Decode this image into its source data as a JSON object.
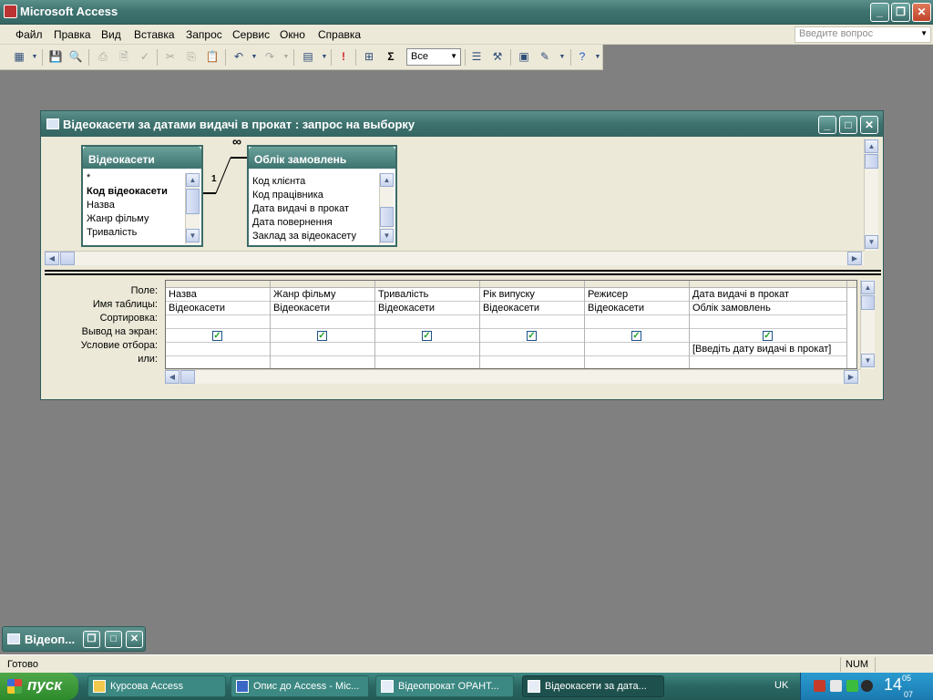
{
  "app": {
    "title": "Microsoft Access"
  },
  "menubar": {
    "items": [
      "Файл",
      "Правка",
      "Вид",
      "Вставка",
      "Запрос",
      "Сервис",
      "Окно",
      "Справка"
    ],
    "ask_placeholder": "Введите вопрос"
  },
  "toolbar": {
    "top_values": "Все"
  },
  "query_window": {
    "title": "Відеокасети за датами видачі в прокат : запрос на выборку",
    "tables": [
      {
        "name": "Відеокасети",
        "fields": [
          "*",
          "Код відеокасети",
          "Назва",
          "Жанр фільму",
          "Тривалість"
        ]
      },
      {
        "name": "Облік замовлень",
        "fields": [
          "Код клієнта",
          "Код працівника",
          "Дата видачі в прокат",
          "Дата повернення",
          "Заклад за відеокасету"
        ]
      }
    ],
    "relation": {
      "one": "1",
      "many": "∞"
    },
    "row_labels": [
      "Поле:",
      "Имя таблицы:",
      "Сортировка:",
      "Вывод на экран:",
      "Условие отбора:",
      "или:"
    ],
    "columns": [
      {
        "field": "Назва",
        "table": "Відеокасети",
        "show": true,
        "criteria": ""
      },
      {
        "field": "Жанр фільму",
        "table": "Відеокасети",
        "show": true,
        "criteria": ""
      },
      {
        "field": "Тривалість",
        "table": "Відеокасети",
        "show": true,
        "criteria": ""
      },
      {
        "field": "Рік випуску",
        "table": "Відеокасети",
        "show": true,
        "criteria": ""
      },
      {
        "field": "Режисер",
        "table": "Відеокасети",
        "show": true,
        "criteria": ""
      },
      {
        "field": "Дата видачі в прокат",
        "table": "Облік замовлень",
        "show": true,
        "criteria": "[Введіть дату видачі в прокат]"
      }
    ]
  },
  "minimized_window": {
    "title": "Відеоп..."
  },
  "statusbar": {
    "text": "Готово",
    "num": "NUM"
  },
  "taskbar": {
    "start_label": "пуск",
    "tasks": [
      {
        "label": "Курсова Access"
      },
      {
        "label": "Опис до Access - Mic..."
      },
      {
        "label": "Відеопрокат ОРАНТ..."
      },
      {
        "label": "Відеокасети за дата..."
      }
    ],
    "language": "UK",
    "clock_hour": "14",
    "clock_min": "05",
    "clock_sec": "07"
  }
}
